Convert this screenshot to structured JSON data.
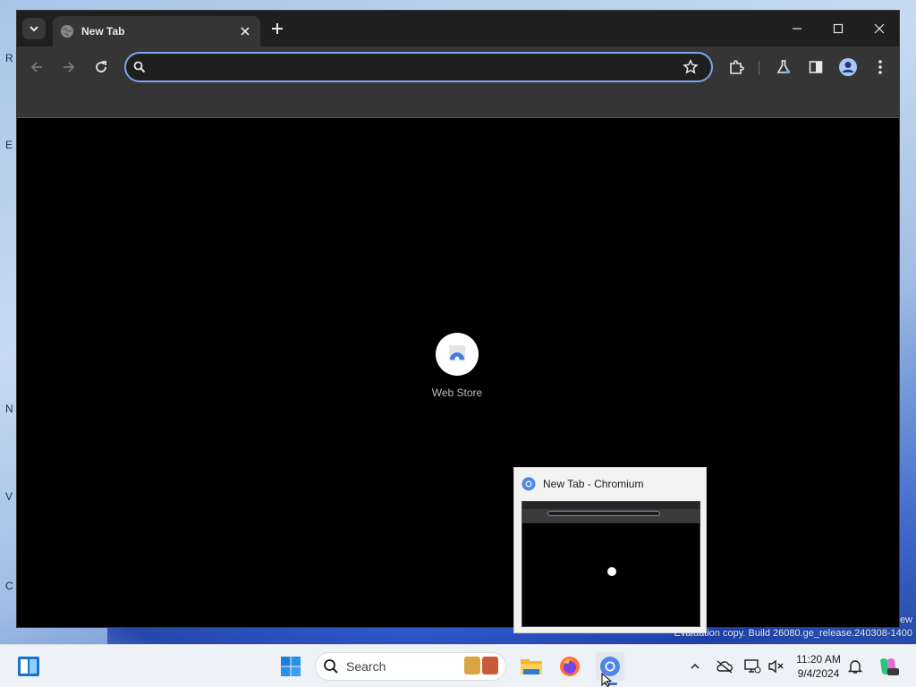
{
  "browser": {
    "tab": {
      "title": "New Tab"
    },
    "omnibox": {
      "value": "",
      "placeholder": ""
    },
    "new_tab_page": {
      "shortcut": {
        "label": "Web Store"
      }
    }
  },
  "preview": {
    "title": "New Tab - Chromium"
  },
  "watermark": {
    "line1": "ew",
    "line2": "Evaluation copy. Build 26080.ge_release.240308-1400"
  },
  "taskbar": {
    "search": {
      "label": "Search"
    },
    "clock": {
      "time": "11:20 AM",
      "date": "9/4/2024"
    }
  },
  "colors": {
    "accent": "#7ca4f3",
    "window_bg": "#000000",
    "toolbar_bg": "#353535",
    "taskbar_bg": "#eef1f6"
  },
  "icons": {
    "tab_search": "chevron-down-icon",
    "tab_favicon": "globe-icon",
    "tab_close": "close-icon",
    "new_tab": "plus-icon",
    "minimize": "minimize-icon",
    "maximize": "maximize-icon",
    "close": "close-icon",
    "back": "arrow-left-icon",
    "forward": "arrow-right-icon",
    "reload": "reload-icon",
    "bookmark": "star-icon",
    "extensions": "puzzle-icon",
    "labs": "flask-icon",
    "side_panel": "side-panel-icon",
    "profile": "profile-icon",
    "menu": "kebab-menu-icon"
  }
}
